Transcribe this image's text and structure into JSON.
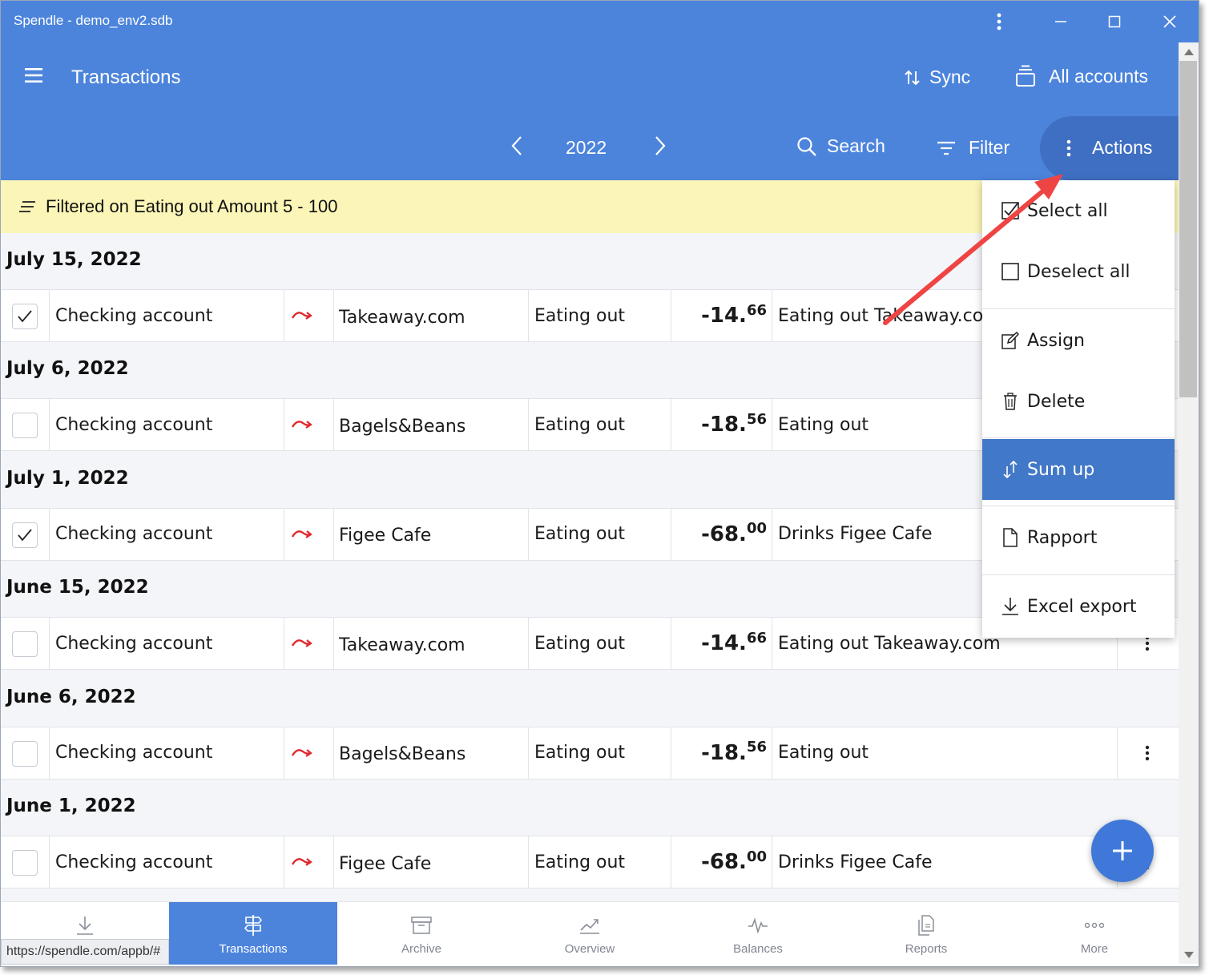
{
  "window": {
    "title": "Spendle - demo_env2.sdb"
  },
  "header": {
    "menu_icon": "hamburger-icon",
    "title": "Transactions",
    "sync_label": "Sync",
    "accounts_label": "All accounts",
    "year": "2022",
    "search_label": "Search",
    "filter_label": "Filter",
    "actions_label": "Actions"
  },
  "banner": {
    "text": "Filtered on Eating out Amount 5 - 100"
  },
  "groups": [
    {
      "date": "July 15, 2022",
      "row": {
        "checked": true,
        "account": "Checking account",
        "payee": "Takeaway.com",
        "category": "Eating out",
        "amount_int": "-14.",
        "amount_dec": "66",
        "description": "Eating out Takeaway.com"
      }
    },
    {
      "date": "July 6, 2022",
      "row": {
        "checked": false,
        "account": "Checking account",
        "payee": "Bagels&Beans",
        "category": "Eating out",
        "amount_int": "-18.",
        "amount_dec": "56",
        "description": "Eating out"
      }
    },
    {
      "date": "July 1, 2022",
      "row": {
        "checked": true,
        "account": "Checking account",
        "payee": "Figee Cafe",
        "category": "Eating out",
        "amount_int": "-68.",
        "amount_dec": "00",
        "description": "Drinks Figee Cafe"
      }
    },
    {
      "date": "June 15, 2022",
      "row": {
        "checked": false,
        "account": "Checking account",
        "payee": "Takeaway.com",
        "category": "Eating out",
        "amount_int": "-14.",
        "amount_dec": "66",
        "description": "Eating out Takeaway.com"
      }
    },
    {
      "date": "June 6, 2022",
      "row": {
        "checked": false,
        "account": "Checking account",
        "payee": "Bagels&Beans",
        "category": "Eating out",
        "amount_int": "-18.",
        "amount_dec": "56",
        "description": "Eating out"
      }
    },
    {
      "date": "June 1, 2022",
      "row": {
        "checked": false,
        "account": "Checking account",
        "payee": "Figee Cafe",
        "category": "Eating out",
        "amount_int": "-68.",
        "amount_dec": "00",
        "description": "Drinks Figee Cafe"
      }
    }
  ],
  "actions_menu": {
    "items": [
      {
        "label": "Select all",
        "icon": "checkbox-checked-icon"
      },
      {
        "label": "Deselect all",
        "icon": "checkbox-empty-icon"
      },
      {
        "label": "Assign",
        "icon": "pencil-edit-icon"
      },
      {
        "label": "Delete",
        "icon": "trash-icon"
      },
      {
        "label": "Sum up",
        "icon": "sum-up-arrows-icon",
        "active": true
      },
      {
        "label": "Rapport",
        "icon": "document-icon"
      },
      {
        "label": "Excel export",
        "icon": "download-icon"
      }
    ]
  },
  "bottom_nav": [
    {
      "label": "",
      "icon": "download-icon"
    },
    {
      "label": "Transactions",
      "icon": "signpost-icon",
      "active": true
    },
    {
      "label": "Archive",
      "icon": "archive-box-icon"
    },
    {
      "label": "Overview",
      "icon": "trend-chart-icon"
    },
    {
      "label": "Balances",
      "icon": "pulse-icon"
    },
    {
      "label": "Reports",
      "icon": "reports-icon"
    },
    {
      "label": "More",
      "icon": "more-dots-icon"
    }
  ],
  "status_url": "https://spendle.com/appb/#",
  "colors": {
    "brand_blue": "#4c84dc",
    "banner_yellow": "#fbf6b8",
    "expense_red": "#e0282e",
    "annotation_arrow": "#ef4444"
  }
}
